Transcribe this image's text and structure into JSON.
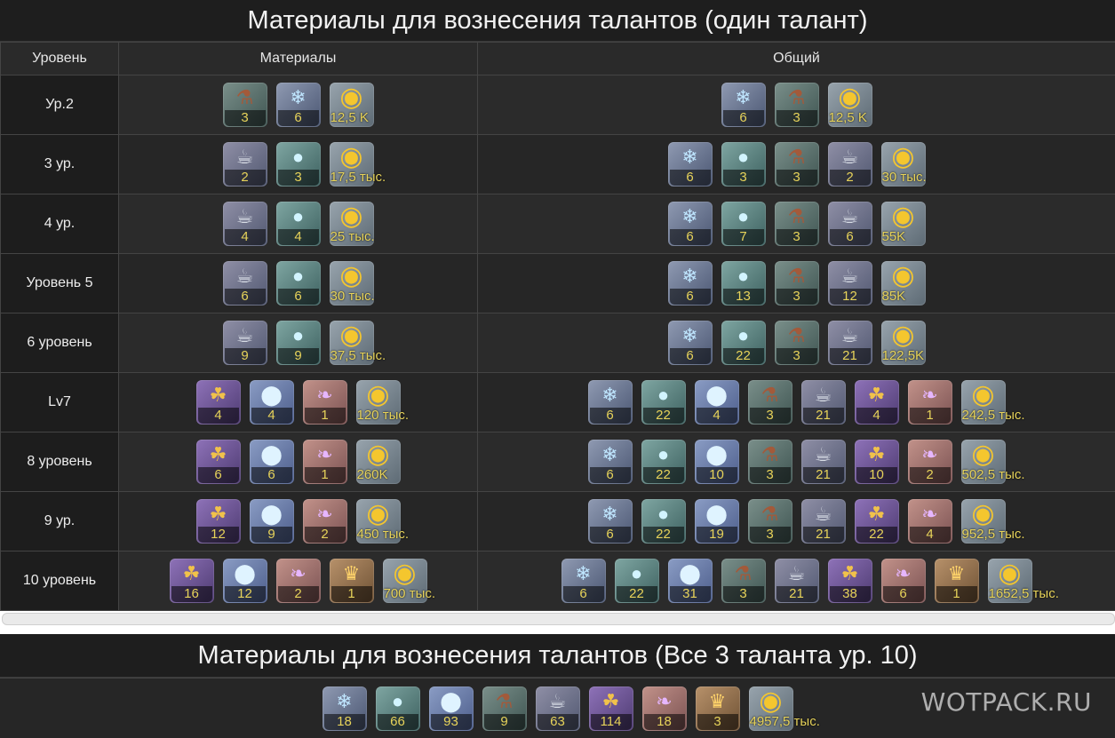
{
  "title1": "Материалы для вознесения талантов (один талант)",
  "headers": {
    "level": "Уровень",
    "materials": "Материалы",
    "total": "Общий"
  },
  "rows": [
    {
      "level": "Ур.2",
      "materials": [
        {
          "icon": "gourd",
          "qty": "3"
        },
        {
          "icon": "crystal",
          "qty": "6"
        },
        {
          "icon": "coin",
          "qty": "12,5 K"
        }
      ],
      "total": [
        {
          "icon": "crystal",
          "qty": "6"
        },
        {
          "icon": "gourd",
          "qty": "3"
        },
        {
          "icon": "coin",
          "qty": "12,5 K"
        }
      ]
    },
    {
      "level": "3 ур.",
      "materials": [
        {
          "icon": "pot",
          "qty": "2"
        },
        {
          "icon": "drop",
          "qty": "3"
        },
        {
          "icon": "coin",
          "qty": "17,5 тыс."
        }
      ],
      "total": [
        {
          "icon": "crystal",
          "qty": "6"
        },
        {
          "icon": "drop",
          "qty": "3"
        },
        {
          "icon": "gourd",
          "qty": "3"
        },
        {
          "icon": "pot",
          "qty": "2"
        },
        {
          "icon": "coin",
          "qty": "30 тыс."
        }
      ]
    },
    {
      "level": "4 ур.",
      "materials": [
        {
          "icon": "pot",
          "qty": "4"
        },
        {
          "icon": "drop",
          "qty": "4"
        },
        {
          "icon": "coin",
          "qty": "25 тыс."
        }
      ],
      "total": [
        {
          "icon": "crystal",
          "qty": "6"
        },
        {
          "icon": "drop",
          "qty": "7"
        },
        {
          "icon": "gourd",
          "qty": "3"
        },
        {
          "icon": "pot",
          "qty": "6"
        },
        {
          "icon": "coin",
          "qty": "55K"
        }
      ]
    },
    {
      "level": "Уровень 5",
      "materials": [
        {
          "icon": "pot",
          "qty": "6"
        },
        {
          "icon": "drop",
          "qty": "6"
        },
        {
          "icon": "coin",
          "qty": "30 тыс."
        }
      ],
      "total": [
        {
          "icon": "crystal",
          "qty": "6"
        },
        {
          "icon": "drop",
          "qty": "13"
        },
        {
          "icon": "gourd",
          "qty": "3"
        },
        {
          "icon": "pot",
          "qty": "12"
        },
        {
          "icon": "coin",
          "qty": "85K"
        }
      ]
    },
    {
      "level": "6 уровень",
      "materials": [
        {
          "icon": "pot",
          "qty": "9"
        },
        {
          "icon": "drop",
          "qty": "9"
        },
        {
          "icon": "coin",
          "qty": "37,5 тыс."
        }
      ],
      "total": [
        {
          "icon": "crystal",
          "qty": "6"
        },
        {
          "icon": "drop",
          "qty": "22"
        },
        {
          "icon": "gourd",
          "qty": "3"
        },
        {
          "icon": "pot",
          "qty": "21"
        },
        {
          "icon": "coin",
          "qty": "122,5K"
        }
      ]
    },
    {
      "level": "Lv7",
      "materials": [
        {
          "icon": "golden",
          "qty": "4"
        },
        {
          "icon": "orb",
          "qty": "4"
        },
        {
          "icon": "shell",
          "qty": "1"
        },
        {
          "icon": "coin",
          "qty": "120 тыс."
        }
      ],
      "total": [
        {
          "icon": "crystal",
          "qty": "6"
        },
        {
          "icon": "drop",
          "qty": "22"
        },
        {
          "icon": "orb",
          "qty": "4"
        },
        {
          "icon": "gourd",
          "qty": "3"
        },
        {
          "icon": "pot",
          "qty": "21"
        },
        {
          "icon": "golden",
          "qty": "4"
        },
        {
          "icon": "shell",
          "qty": "1"
        },
        {
          "icon": "coin",
          "qty": "242,5 тыс."
        }
      ]
    },
    {
      "level": "8 уровень",
      "materials": [
        {
          "icon": "golden",
          "qty": "6"
        },
        {
          "icon": "orb",
          "qty": "6"
        },
        {
          "icon": "shell",
          "qty": "1"
        },
        {
          "icon": "coin",
          "qty": "260K"
        }
      ],
      "total": [
        {
          "icon": "crystal",
          "qty": "6"
        },
        {
          "icon": "drop",
          "qty": "22"
        },
        {
          "icon": "orb",
          "qty": "10"
        },
        {
          "icon": "gourd",
          "qty": "3"
        },
        {
          "icon": "pot",
          "qty": "21"
        },
        {
          "icon": "golden",
          "qty": "10"
        },
        {
          "icon": "shell",
          "qty": "2"
        },
        {
          "icon": "coin",
          "qty": "502,5 тыс."
        }
      ]
    },
    {
      "level": "9 ур.",
      "materials": [
        {
          "icon": "golden",
          "qty": "12"
        },
        {
          "icon": "orb",
          "qty": "9"
        },
        {
          "icon": "shell",
          "qty": "2"
        },
        {
          "icon": "coin",
          "qty": "450 тыс."
        }
      ],
      "total": [
        {
          "icon": "crystal",
          "qty": "6"
        },
        {
          "icon": "drop",
          "qty": "22"
        },
        {
          "icon": "orb",
          "qty": "19"
        },
        {
          "icon": "gourd",
          "qty": "3"
        },
        {
          "icon": "pot",
          "qty": "21"
        },
        {
          "icon": "golden",
          "qty": "22"
        },
        {
          "icon": "shell",
          "qty": "4"
        },
        {
          "icon": "coin",
          "qty": "952,5 тыс."
        }
      ]
    },
    {
      "level": "10 уровень",
      "materials": [
        {
          "icon": "golden",
          "qty": "16"
        },
        {
          "icon": "orb",
          "qty": "12"
        },
        {
          "icon": "shell",
          "qty": "2"
        },
        {
          "icon": "crown",
          "qty": "1"
        },
        {
          "icon": "coin",
          "qty": "700 тыс."
        }
      ],
      "total": [
        {
          "icon": "crystal",
          "qty": "6"
        },
        {
          "icon": "drop",
          "qty": "22"
        },
        {
          "icon": "orb",
          "qty": "31"
        },
        {
          "icon": "gourd",
          "qty": "3"
        },
        {
          "icon": "pot",
          "qty": "21"
        },
        {
          "icon": "golden",
          "qty": "38"
        },
        {
          "icon": "shell",
          "qty": "6"
        },
        {
          "icon": "crown",
          "qty": "1"
        },
        {
          "icon": "coin",
          "qty": "1652,5 тыс."
        }
      ]
    }
  ],
  "title2": "Материалы для вознесения талантов (Все 3 таланта ур. 10)",
  "grand_total": [
    {
      "icon": "crystal",
      "qty": "18"
    },
    {
      "icon": "drop",
      "qty": "66"
    },
    {
      "icon": "orb",
      "qty": "93"
    },
    {
      "icon": "gourd",
      "qty": "9"
    },
    {
      "icon": "pot",
      "qty": "63"
    },
    {
      "icon": "golden",
      "qty": "114"
    },
    {
      "icon": "shell",
      "qty": "18"
    },
    {
      "icon": "crown",
      "qty": "3"
    },
    {
      "icon": "coin",
      "qty": "4957,5 тыс."
    }
  ],
  "watermark": "WOTPACK.RU",
  "colors": {
    "background": "#262626",
    "quantity_text": "#e7d35a",
    "border": "#444444"
  }
}
